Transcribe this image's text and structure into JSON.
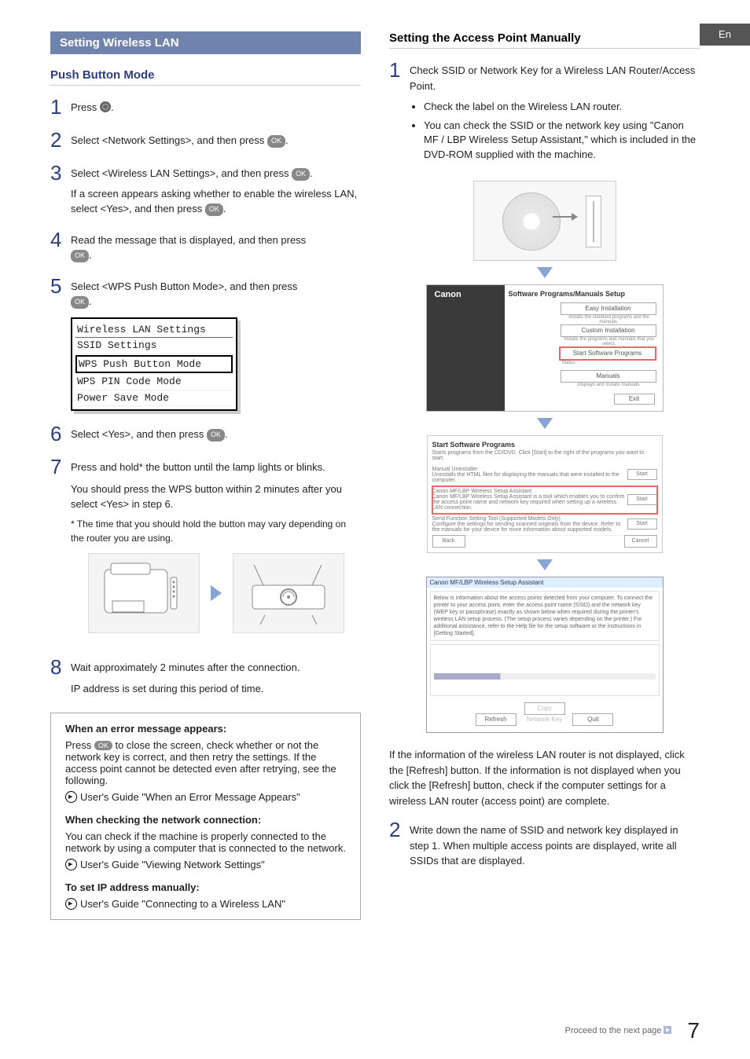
{
  "lang_tab": "En",
  "page_number": "7",
  "proceed_text": "Proceed to the next page",
  "left": {
    "section_bar": "Setting Wireless LAN",
    "sub": "Push Button Mode",
    "s1": "Press ",
    "s1_end": ".",
    "s2a": "Select <Network Settings>, and then press ",
    "s2b": ".",
    "s3a": "Select <Wireless LAN Settings>, and then press ",
    "s3b": ".",
    "s3c": "If a screen appears asking whether to enable the wireless LAN, select <Yes>, and then press ",
    "s3d": ".",
    "s4a": "Read the message that is displayed, and then press ",
    "s4b": ".",
    "s5a": "Select <WPS Push Button Mode>, and then press ",
    "s5b": ".",
    "lcd": {
      "title": "Wireless LAN Settings",
      "i1": "SSID Settings",
      "i2": "WPS Push Button Mode",
      "i3": "WPS PIN Code Mode",
      "i4": "Power Save Mode"
    },
    "s6a": "Select <Yes>, and then press ",
    "s6b": ".",
    "s7a": "Press and hold* the button until the lamp lights or blinks.",
    "s7b": "You should press the WPS button within 2 minutes after you select <Yes> in step 6.",
    "s7c": "* The time that you should hold the button may vary depending on the router you are using.",
    "s8a": "Wait approximately 2 minutes after the connection.",
    "s8b": "IP address is set during this period of time.",
    "note1_hdr": "When an error message appears:",
    "note1a": "Press ",
    "note1b": " to close the screen, check whether or not the network key is correct, and then retry the settings. If the access point cannot be detected even after retrying, see the following.",
    "note1c": "User's Guide \"When an Error Message Appears\"",
    "note2_hdr": "When checking the network connection:",
    "note2a": "You can check if the machine is properly connected to the network by using a computer that is connected to the network.",
    "note2b": "User's Guide \"Viewing Network Settings\"",
    "note3_hdr": "To set IP address manually:",
    "note3a": "User's Guide \"Connecting to a Wireless LAN\""
  },
  "right": {
    "sub": "Setting the Access Point Manually",
    "s1a": "Check SSID or Network Key for a Wireless LAN Router/Access Point.",
    "s1b1": "Check the label on the Wireless LAN router.",
    "s1b2": "You can check the SSID or the network key using \"Canon MF / LBP Wireless Setup Assistant,\" which is included in the DVD-ROM supplied with the machine.",
    "installer": {
      "brand": "Canon",
      "title": "Software Programs/Manuals Setup",
      "btn1": "Easy Installation",
      "sub1": "Installs the standard programs and the manuals.",
      "btn2": "Custom Installation",
      "sub2": "Installs the programs and manuals that you select.",
      "btn3": "Start Software Programs",
      "sub3": "Status:",
      "btn4": "Manuals",
      "sub4": "Displays and installs manuals.",
      "exit": "Exit"
    },
    "list": {
      "title": "Start Software Programs",
      "lead": "Starts programs from the CD/DVD. Click [Start] to the right of the programs you want to start.",
      "r1": "Manual Uninstaller\nUninstalls the HTML files for displaying the manuals that were installed to the computer.",
      "r2": "Canon MF/LBP Wireless Setup Assistant\nCanon MF/LBP Wireless Setup Assistant is a tool which enables you to confirm the access point name and network key required when setting up a wireless LAN connection.",
      "r3": "Send Function Setting Tool (Supported Models Only)\nConfigure the settings for sending scanned originals from the device. Refer to the manuals for your device for more information about supported models.",
      "start": "Start",
      "back": "Back",
      "cancel": "Cancel"
    },
    "assist": {
      "bar": "Canon MF/LBP Wireless Setup Assistant",
      "box": "Below is information about the access points detected from your computer.\nTo connect the printer to your access point, enter the access point name (SSID) and the network key (WEP key or passphrase) exactly as shown below when required during the printer's wireless LAN setup process. (The setup process varies depending on the printer.)\nFor additional assistance, refer to the Help file for the setup software or the instructions in [Getting Started].",
      "refresh": "Refresh",
      "copy": "Copy Network Key",
      "quit": "Quit"
    },
    "after_figs": "If the information of the wireless LAN router is not displayed, click the [Refresh] button. If the information is not displayed when you click the [Refresh] button, check if the computer settings for a wireless LAN router (access point) are complete.",
    "s2": "Write down the name of SSID and network key displayed in step 1. When multiple access points are displayed, write all SSIDs that are displayed."
  },
  "ok_label": "OK"
}
